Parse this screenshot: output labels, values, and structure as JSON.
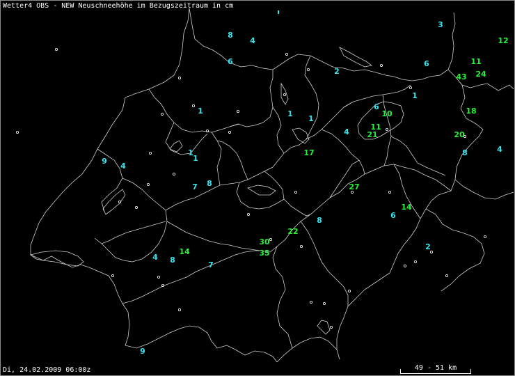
{
  "title": "Wetter4 OBS - NEW Neuschneehöhe im Bezugszeitraum in cm",
  "timestamp": "Di, 24.02.2009 06:00z",
  "scale_label": "49 - 51 km",
  "colors": {
    "low": "#39e3ee",
    "high": "#25f03a",
    "border": "#d0d0d0"
  },
  "values": [
    {
      "v": "8",
      "c": "low"
    },
    {
      "v": "4",
      "c": "low"
    },
    {
      "v": "6",
      "c": "low"
    },
    {
      "v": "3",
      "c": "low"
    },
    {
      "v": "12",
      "c": "high"
    },
    {
      "v": "11",
      "c": "high"
    },
    {
      "v": "43",
      "c": "high"
    },
    {
      "v": "24",
      "c": "high"
    },
    {
      "v": "6",
      "c": "low"
    },
    {
      "v": "2",
      "c": "low"
    },
    {
      "v": "1",
      "c": "low"
    },
    {
      "v": "6",
      "c": "low"
    },
    {
      "v": "10",
      "c": "high"
    },
    {
      "v": "18",
      "c": "high"
    },
    {
      "v": "1",
      "c": "low"
    },
    {
      "v": "1",
      "c": "low"
    },
    {
      "v": "1",
      "c": "low"
    },
    {
      "v": "4",
      "c": "low"
    },
    {
      "v": "11",
      "c": "high"
    },
    {
      "v": "21",
      "c": "high"
    },
    {
      "v": "20",
      "c": "high"
    },
    {
      "v": "8",
      "c": "low"
    },
    {
      "v": "4",
      "c": "low"
    },
    {
      "v": "1",
      "c": "low"
    },
    {
      "v": "1",
      "c": "low"
    },
    {
      "v": "9",
      "c": "low"
    },
    {
      "v": "4",
      "c": "low"
    },
    {
      "v": "17",
      "c": "high"
    },
    {
      "v": "7",
      "c": "low"
    },
    {
      "v": "8",
      "c": "low"
    },
    {
      "v": "27",
      "c": "high"
    },
    {
      "v": "14",
      "c": "high"
    },
    {
      "v": "6",
      "c": "low"
    },
    {
      "v": "8",
      "c": "low"
    },
    {
      "v": "22",
      "c": "high"
    },
    {
      "v": "30",
      "c": "high"
    },
    {
      "v": "35",
      "c": "high"
    },
    {
      "v": "2",
      "c": "low"
    },
    {
      "v": "4",
      "c": "low"
    },
    {
      "v": "8",
      "c": "low"
    },
    {
      "v": "14",
      "c": "high"
    },
    {
      "v": "7",
      "c": "low"
    },
    {
      "v": "9",
      "c": "low"
    }
  ]
}
